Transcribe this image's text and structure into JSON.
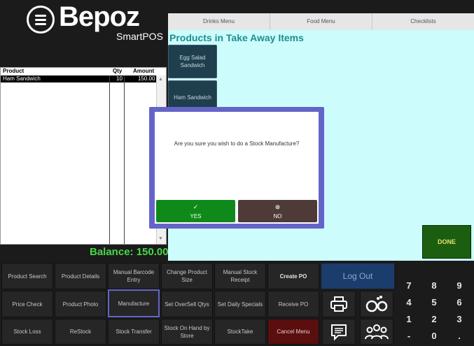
{
  "brand": {
    "name": "Bepoz",
    "product": "SmartPOS",
    "logo_icon": "menu-icon"
  },
  "tabs": [
    "Drinks Menu",
    "Food Menu",
    "Checklists"
  ],
  "main": {
    "title": "Products in Take Away Items",
    "products": [
      "Egg Salad Sandwich",
      "Ham Sandwich"
    ],
    "done_label": "DONE"
  },
  "order": {
    "headers": {
      "product": "Product",
      "qty": "Qty",
      "amount": "Amount"
    },
    "rows": [
      {
        "product": "Ham Sandwich",
        "qty": "10",
        "amount": "150.00"
      }
    ],
    "scroll_up": "▲",
    "scroll_down": "▼"
  },
  "balance": "Balance: 150.00",
  "functions": {
    "row1": [
      "Product Search",
      "Product Details",
      "Manual Barcode Entry",
      "Change Product Size",
      "Manual Stock Receipt",
      "Create PO"
    ],
    "row2": [
      "Price Check",
      "Product Photo",
      "Manufacture",
      "Set OverSell Qtys",
      "Set Daily Specials",
      "Receive PO"
    ],
    "row3": [
      "Stock Loss",
      "ReStock",
      "Stock Transfer",
      "Stock On Hand by Store",
      "StockTake",
      "Cancel Menu"
    ],
    "logout": "Log Out",
    "icons": [
      "printer-icon",
      "handcuffs-icon",
      "message-icon",
      "group-icon"
    ]
  },
  "keypad": [
    "7",
    "8",
    "9",
    "4",
    "5",
    "6",
    "1",
    "2",
    "3",
    "-",
    "0",
    "."
  ],
  "dialog": {
    "message": "Are you sure you wish to do a Stock Manufacture?",
    "yes_label": "YES",
    "yes_mark": "✓",
    "no_label": "NO",
    "no_mark": "⊗"
  },
  "colors": {
    "accent": "#6464c8",
    "yes": "#0f8a1a",
    "balance": "#48d848",
    "main_bg": "#cdfcfc"
  }
}
